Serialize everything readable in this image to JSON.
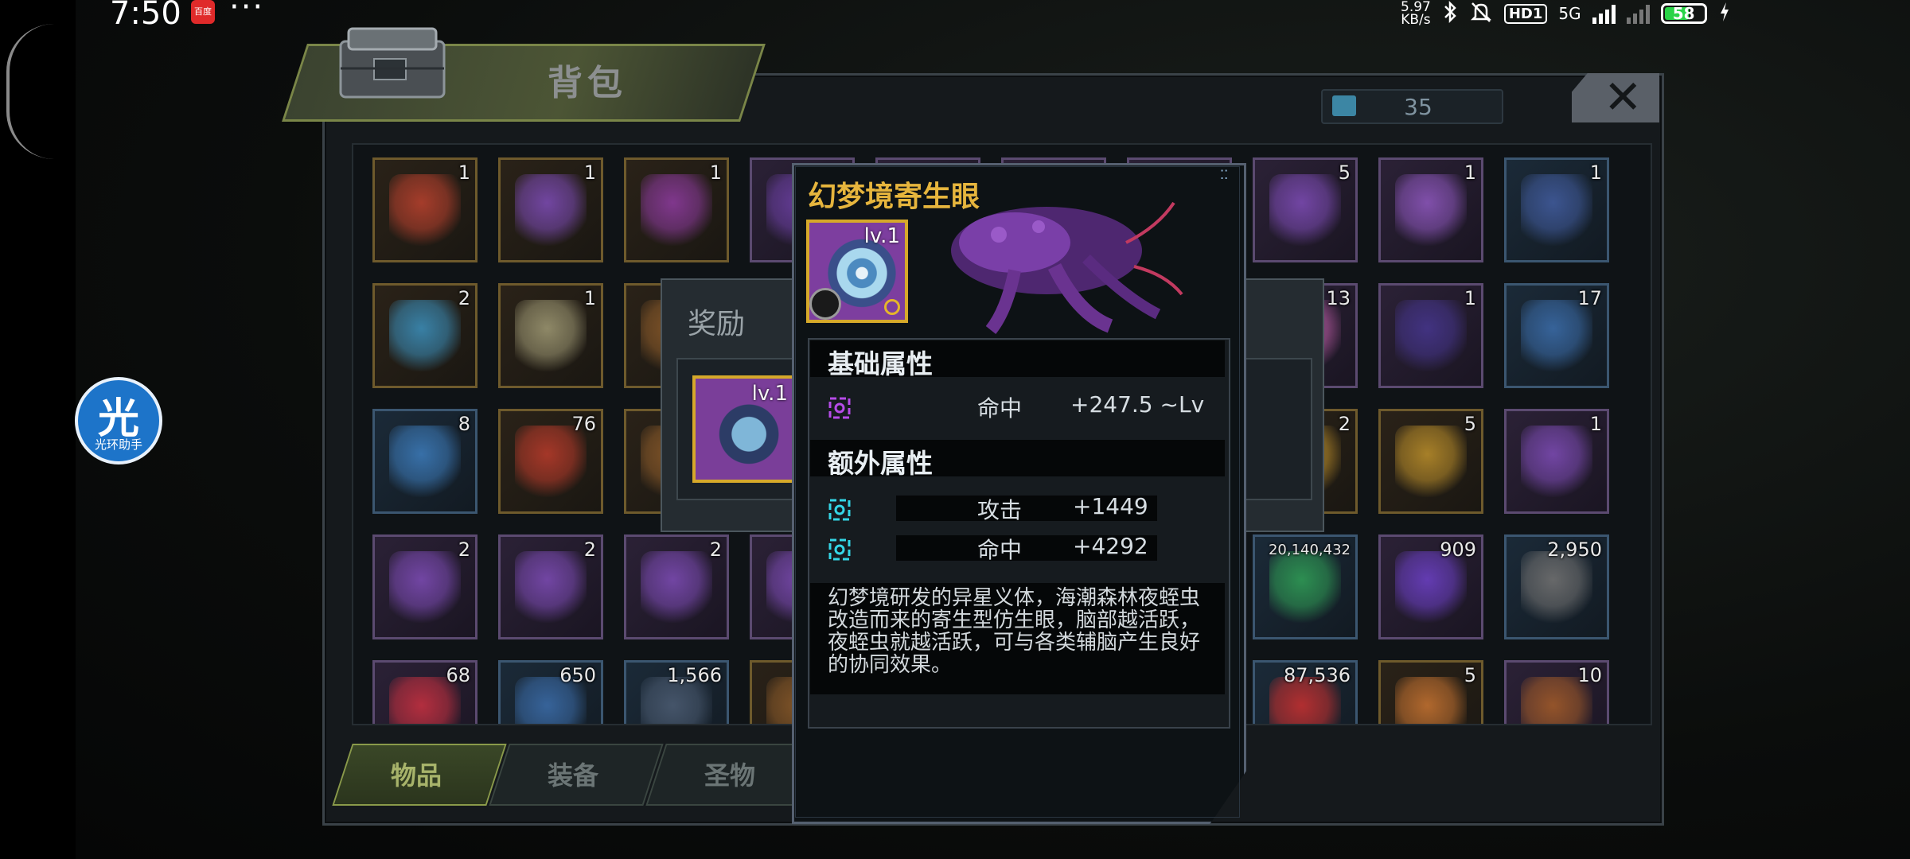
{
  "status_bar": {
    "time": "7:50",
    "app_badge": "百度",
    "more": "···",
    "net_speed_top": "5.97",
    "net_speed_bottom": "KB/s",
    "hd_label": "HD1",
    "net_type": "5G",
    "battery": "58"
  },
  "assistant": {
    "glyph": "光",
    "label": "光环助手"
  },
  "backpack": {
    "title": "背包",
    "capacity_count": "35",
    "close_icon": "close-x-icon",
    "tabs": [
      {
        "label": "物品",
        "active": true
      },
      {
        "label": "装备",
        "active": false
      },
      {
        "label": "圣物",
        "active": false
      }
    ],
    "items": [
      {
        "qty": "1",
        "theme": "gold",
        "art": "#b3402d"
      },
      {
        "qty": "1",
        "theme": "gold",
        "art": "#7a4ab0"
      },
      {
        "qty": "1",
        "theme": "gold",
        "art": "#8a3a9a"
      },
      {
        "qty": "",
        "theme": "purple",
        "art": "#6a3fa0"
      },
      {
        "qty": "",
        "theme": "purple",
        "art": "#6a3fa0"
      },
      {
        "qty": "",
        "theme": "purple",
        "art": "#6a3fa0"
      },
      {
        "qty": "",
        "theme": "purple",
        "art": "#6a3fa0"
      },
      {
        "qty": "5",
        "theme": "purple",
        "art": "#7a4ab0"
      },
      {
        "qty": "1",
        "theme": "purple",
        "art": "#8a55b8"
      },
      {
        "qty": "1",
        "theme": "blue",
        "art": "#405a9a"
      },
      {
        "qty": "2",
        "theme": "gold",
        "art": "#3b8bb5"
      },
      {
        "qty": "1",
        "theme": "gold",
        "art": "#9a9470"
      },
      {
        "qty": "",
        "theme": "gold",
        "art": "#8a5a2a"
      },
      {
        "qty": "",
        "theme": "gold",
        "art": "#8a5a2a"
      },
      {
        "qty": "",
        "theme": "gold",
        "art": "#8a5a2a"
      },
      {
        "qty": "",
        "theme": "gold",
        "art": "#8a5a2a"
      },
      {
        "qty": "",
        "theme": "gold",
        "art": "#8a5a2a"
      },
      {
        "qty": "13",
        "theme": "purple",
        "art": "#b45aa0"
      },
      {
        "qty": "1",
        "theme": "purple",
        "art": "#45358a"
      },
      {
        "qty": "17",
        "theme": "blue",
        "art": "#3a6aa5"
      },
      {
        "qty": "8",
        "theme": "blue",
        "art": "#3b78b5"
      },
      {
        "qty": "76",
        "theme": "gold",
        "art": "#b33a2a"
      },
      {
        "qty": "",
        "theme": "gold",
        "art": "#8a5a2a"
      },
      {
        "qty": "",
        "theme": "gold",
        "art": "#8a5a2a"
      },
      {
        "qty": "",
        "theme": "gold",
        "art": "#8a5a2a"
      },
      {
        "qty": "",
        "theme": "gold",
        "art": "#8a5a2a"
      },
      {
        "qty": "",
        "theme": "gold",
        "art": "#8a5a2a"
      },
      {
        "qty": "2",
        "theme": "gold",
        "art": "#b58a2a"
      },
      {
        "qty": "5",
        "theme": "gold",
        "art": "#b58a2a"
      },
      {
        "qty": "1",
        "theme": "purple",
        "art": "#7a4ab0"
      },
      {
        "qty": "2",
        "theme": "purple",
        "art": "#7a4ab0"
      },
      {
        "qty": "2",
        "theme": "purple",
        "art": "#7a4ab0"
      },
      {
        "qty": "2",
        "theme": "purple",
        "art": "#7a4ab0"
      },
      {
        "qty": "",
        "theme": "purple",
        "art": "#7a4ab0"
      },
      {
        "qty": "",
        "theme": "purple",
        "art": "#7a4ab0"
      },
      {
        "qty": "",
        "theme": "purple",
        "art": "#7a4ab0"
      },
      {
        "qty": "",
        "theme": "purple",
        "art": "#7a4ab0"
      },
      {
        "qty": "20,140,432",
        "theme": "blue",
        "art": "#2f9a55"
      },
      {
        "qty": "909",
        "theme": "purple",
        "art": "#6a3fc0"
      },
      {
        "qty": "2,950",
        "theme": "blue",
        "art": "#707070"
      },
      {
        "qty": "68",
        "theme": "purple",
        "art": "#c23040"
      },
      {
        "qty": "650",
        "theme": "blue",
        "art": "#3a6aa5"
      },
      {
        "qty": "1,566",
        "theme": "blue",
        "art": "#4a5a70"
      },
      {
        "qty": "",
        "theme": "gold",
        "art": "#8a5a2a"
      },
      {
        "qty": "",
        "theme": "gold",
        "art": "#8a5a2a"
      },
      {
        "qty": "",
        "theme": "gold",
        "art": "#8a5a2a"
      },
      {
        "qty": "",
        "theme": "gold",
        "art": "#8a5a2a"
      },
      {
        "qty": "87,536",
        "theme": "blue",
        "art": "#c23030"
      },
      {
        "qty": "5",
        "theme": "gold",
        "art": "#c07030"
      },
      {
        "qty": "10",
        "theme": "purple",
        "art": "#a05a2a"
      }
    ]
  },
  "reward_dialog": {
    "title": "奖励",
    "item_level": "lv.1"
  },
  "tooltip": {
    "name": "幻梦境寄生眼",
    "level": "lv.1",
    "basic_header": "基础属性",
    "basic_attrs": [
      {
        "name": "命中",
        "value": "+247.5 ~Lv"
      }
    ],
    "extra_header": "额外属性",
    "extra_attrs": [
      {
        "name": "攻击",
        "value": "+1449"
      },
      {
        "name": "命中",
        "value": "+4292"
      }
    ],
    "description": "幻梦境研发的异星义体，海潮森林夜蛭虫改造而来的寄生型仿生眼，脑部越活跃，夜蛭虫就越活跃，可与各类辅脑产生良好的协同效果。",
    "name_color": "#e6b53d",
    "frame_color": "#d6a92a"
  }
}
